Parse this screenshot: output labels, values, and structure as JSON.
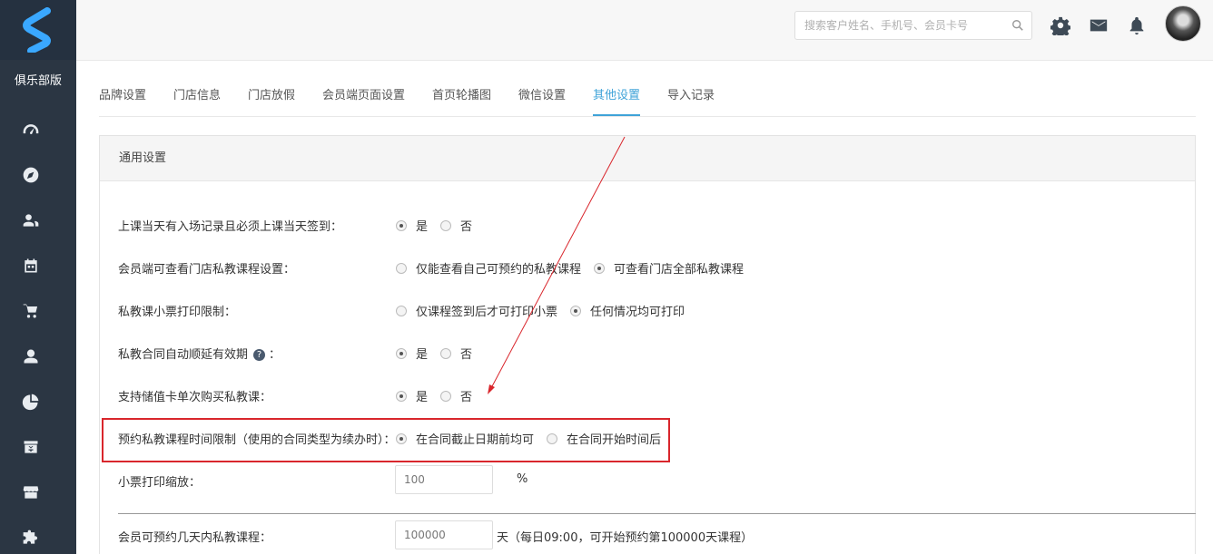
{
  "sidebar": {
    "club_label": "俱乐部版",
    "nav": [
      {
        "icon": "dashboard-icon"
      },
      {
        "icon": "compass-icon"
      },
      {
        "icon": "user-group-icon"
      },
      {
        "icon": "calendar-icon"
      },
      {
        "icon": "cart-icon"
      },
      {
        "icon": "member-icon"
      },
      {
        "icon": "pie-chart-icon"
      },
      {
        "icon": "finance-icon"
      },
      {
        "icon": "store-icon"
      },
      {
        "icon": "puzzle-icon"
      }
    ]
  },
  "header": {
    "search_placeholder": "搜索客户姓名、手机号、会员卡号"
  },
  "tabs": [
    {
      "label": "品牌设置",
      "active": false
    },
    {
      "label": "门店信息",
      "active": false
    },
    {
      "label": "门店放假",
      "active": false
    },
    {
      "label": "会员端页面设置",
      "active": false
    },
    {
      "label": "首页轮播图",
      "active": false
    },
    {
      "label": "微信设置",
      "active": false
    },
    {
      "label": "其他设置",
      "active": true
    },
    {
      "label": "导入记录",
      "active": false
    }
  ],
  "panel": {
    "title": "通用设置",
    "rows": [
      {
        "label": "上课当天有入场记录且必须上课当天签到：",
        "options": [
          "是",
          "否"
        ],
        "selected": 0
      },
      {
        "label": "会员端可查看门店私教课程设置：",
        "options": [
          "仅能查看自己可预约的私教课程",
          "可查看门店全部私教课程"
        ],
        "selected": 1
      },
      {
        "label": "私教课小票打印限制：",
        "options": [
          "仅课程签到后才可打印小票",
          "任何情况均可打印"
        ],
        "selected": 1
      },
      {
        "label": "私教合同自动顺延有效期",
        "label_suffix": "：",
        "help": "?",
        "options": [
          "是",
          "否"
        ],
        "selected": 0
      },
      {
        "label": "支持储值卡单次购买私教课：",
        "options": [
          "是",
          "否"
        ],
        "selected": 0
      },
      {
        "label": "预约私教课程时间限制（使用的合同类型为续办时）：",
        "options": [
          "在合同截止日期前均可",
          "在合同开始时间后"
        ],
        "selected": 0
      }
    ],
    "receipt_scale": {
      "label": "小票打印缩放：",
      "value": "100",
      "unit": "%"
    },
    "booking_days": {
      "label": "会员可预约几天内私教课程：",
      "value": "100000",
      "note": "天（每日09:00，可开始预约第100000天课程）"
    }
  }
}
